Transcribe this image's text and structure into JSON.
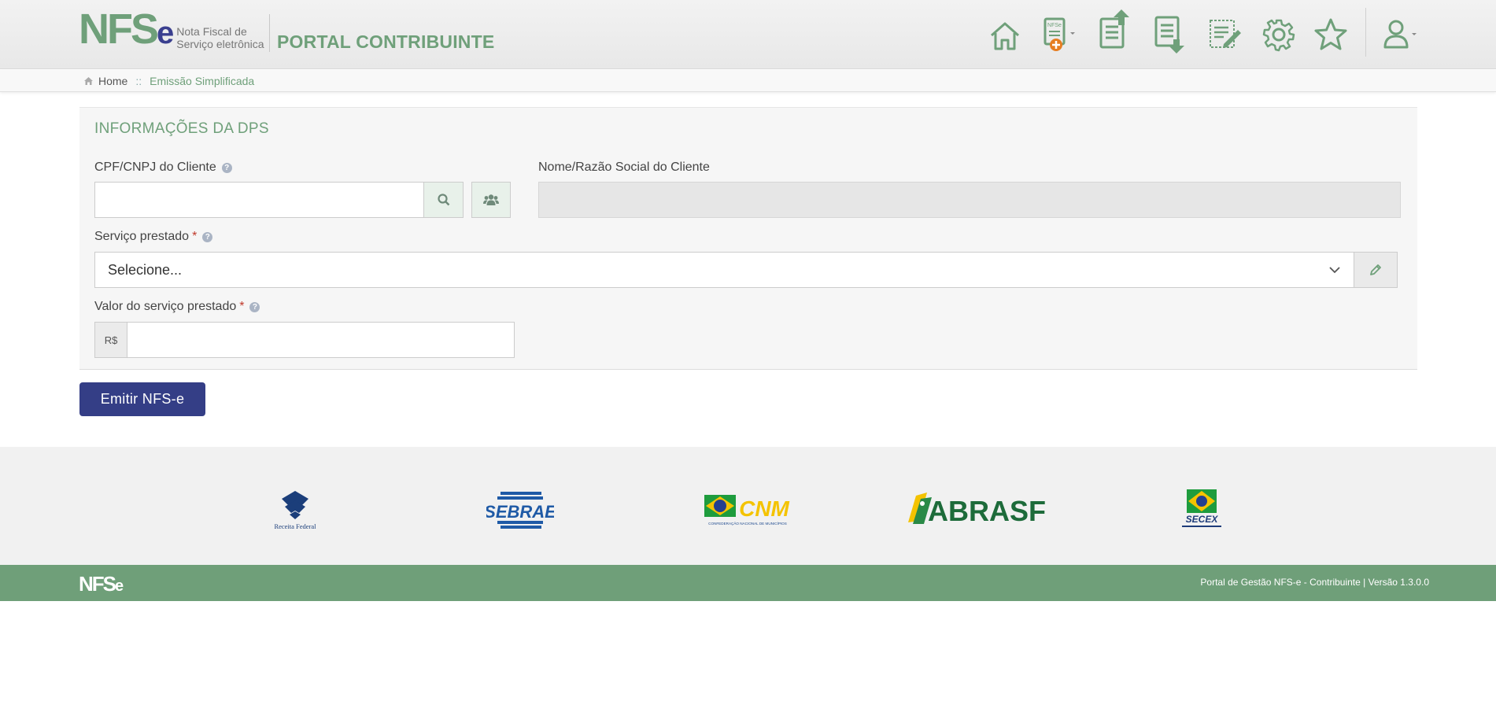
{
  "header": {
    "logo_n": "N",
    "logo_fs": "FS",
    "logo_e": "e",
    "logo_sub_line1": "Nota Fiscal de",
    "logo_sub_line2": "Serviço eletrônica",
    "portal_title": "PORTAL CONTRIBUINTE",
    "nav": [
      {
        "name": "home",
        "icon": "home-icon"
      },
      {
        "name": "new-nfse",
        "icon": "new-document-icon",
        "badge": "NFSe"
      },
      {
        "name": "issued",
        "icon": "upload-document-icon"
      },
      {
        "name": "received",
        "icon": "download-document-icon"
      },
      {
        "name": "dps",
        "icon": "edit-document-icon"
      },
      {
        "name": "settings",
        "icon": "gear-icon"
      },
      {
        "name": "favorites",
        "icon": "star-icon"
      },
      {
        "name": "user",
        "icon": "user-icon"
      }
    ]
  },
  "breadcrumb": {
    "home": "Home",
    "separator": "::",
    "current": "Emissão Simplificada"
  },
  "form": {
    "title": "INFORMAÇÕES DA DPS",
    "cpf_label": "CPF/CNPJ do Cliente",
    "cpf_value": "",
    "name_label": "Nome/Razão Social do Cliente",
    "name_value": "",
    "service_label": "Serviço prestado",
    "service_selected": "Selecione...",
    "value_label": "Valor do serviço prestado",
    "currency_prefix": "R$",
    "value_value": "",
    "required_mark": "*",
    "help_glyph": "?"
  },
  "actions": {
    "emit_label": "Emitir NFS-e"
  },
  "partners": {
    "receita": "Receita Federal",
    "sebrae": "SEBRAE",
    "cnm": "CNM",
    "cnm_sub": "CONFEDERAÇÃO NACIONAL DE MUNICÍPIOS",
    "abrasf": "ABRASF",
    "secex": "SECEX"
  },
  "footer": {
    "logo_main": "NFS",
    "logo_e": "e",
    "text": "Portal de Gestão NFS-e - Contribuinte | Versão 1.3.0.0"
  },
  "colors": {
    "brand_green": "#6fa07a",
    "brand_blue": "#343e86"
  }
}
